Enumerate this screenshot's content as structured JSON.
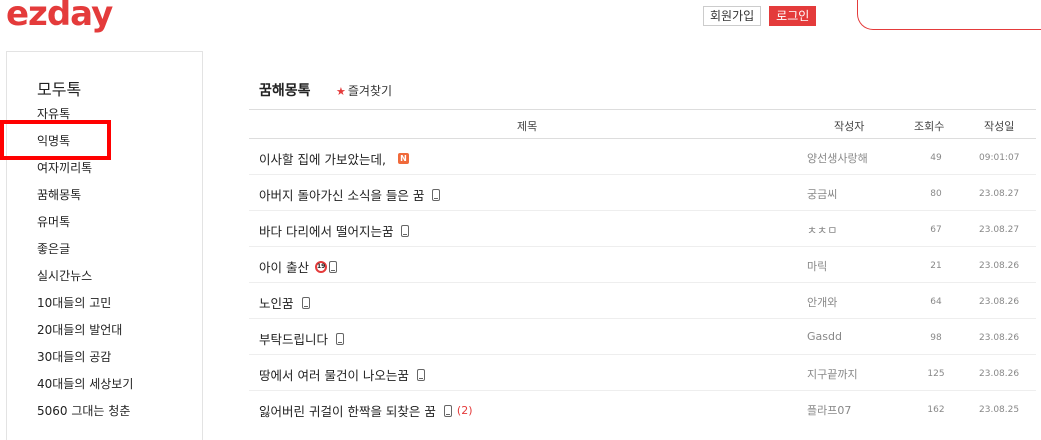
{
  "header": {
    "logo": "ezday",
    "join_label": "회원가입",
    "login_label": "로그인",
    "brand_color": "#e43b3b"
  },
  "sidebar": {
    "title": "모두톡",
    "items": [
      {
        "label": "자유톡"
      },
      {
        "label": "익명톡"
      },
      {
        "label": "여자끼리톡"
      },
      {
        "label": "꿈해몽톡"
      },
      {
        "label": "유머톡"
      },
      {
        "label": "좋은글"
      },
      {
        "label": "실시간뉴스"
      },
      {
        "label": "10대들의 고민"
      },
      {
        "label": "20대들의 발언대"
      },
      {
        "label": "30대들의 공감"
      },
      {
        "label": "40대들의 세상보기"
      },
      {
        "label": "5060 그대는 청춘"
      }
    ],
    "selected": "꿈해몽톡"
  },
  "board": {
    "title": "꿈해몽톡",
    "favorite_label": "즐겨찾기",
    "columns": {
      "title": "제목",
      "author": "작성자",
      "views": "조회수",
      "date": "작성일"
    },
    "posts": [
      {
        "title": "이사할 집에 가보았는데,",
        "icon": "new-badge",
        "badge_text": "N",
        "author": "양선생사랑해",
        "views": "49",
        "date": "09:01:07"
      },
      {
        "title": "아버지 돌아가신 소식을 들은 꿈",
        "icon": "mobile-icon",
        "author": "궁금씨",
        "views": "80",
        "date": "23.08.27"
      },
      {
        "title": "바다 다리에서 떨어지는꿈",
        "icon": "mobile-icon",
        "author": "ㅊㅊㅁ",
        "views": "67",
        "date": "23.08.27"
      },
      {
        "title": "아이 출산",
        "icon": "age-19-icon",
        "age_text": "19",
        "author": "마릭",
        "views": "21",
        "date": "23.08.26"
      },
      {
        "title": "노인꿈",
        "icon": "mobile-icon",
        "author": "안개와",
        "views": "64",
        "date": "23.08.26"
      },
      {
        "title": "부탁드립니다",
        "icon": "mobile-icon",
        "author": "Gasdd",
        "views": "98",
        "date": "23.08.26"
      },
      {
        "title": "땅에서 여러 물건이 나오는꿈",
        "icon": "mobile-icon",
        "author": "지구끝까지",
        "views": "125",
        "date": "23.08.26"
      },
      {
        "title": "잃어버린 귀걸이 한짝을 되찾은 꿈",
        "icon": "mobile-icon",
        "comments": "(2)",
        "author": "플라프07",
        "views": "162",
        "date": "23.08.25"
      }
    ]
  }
}
